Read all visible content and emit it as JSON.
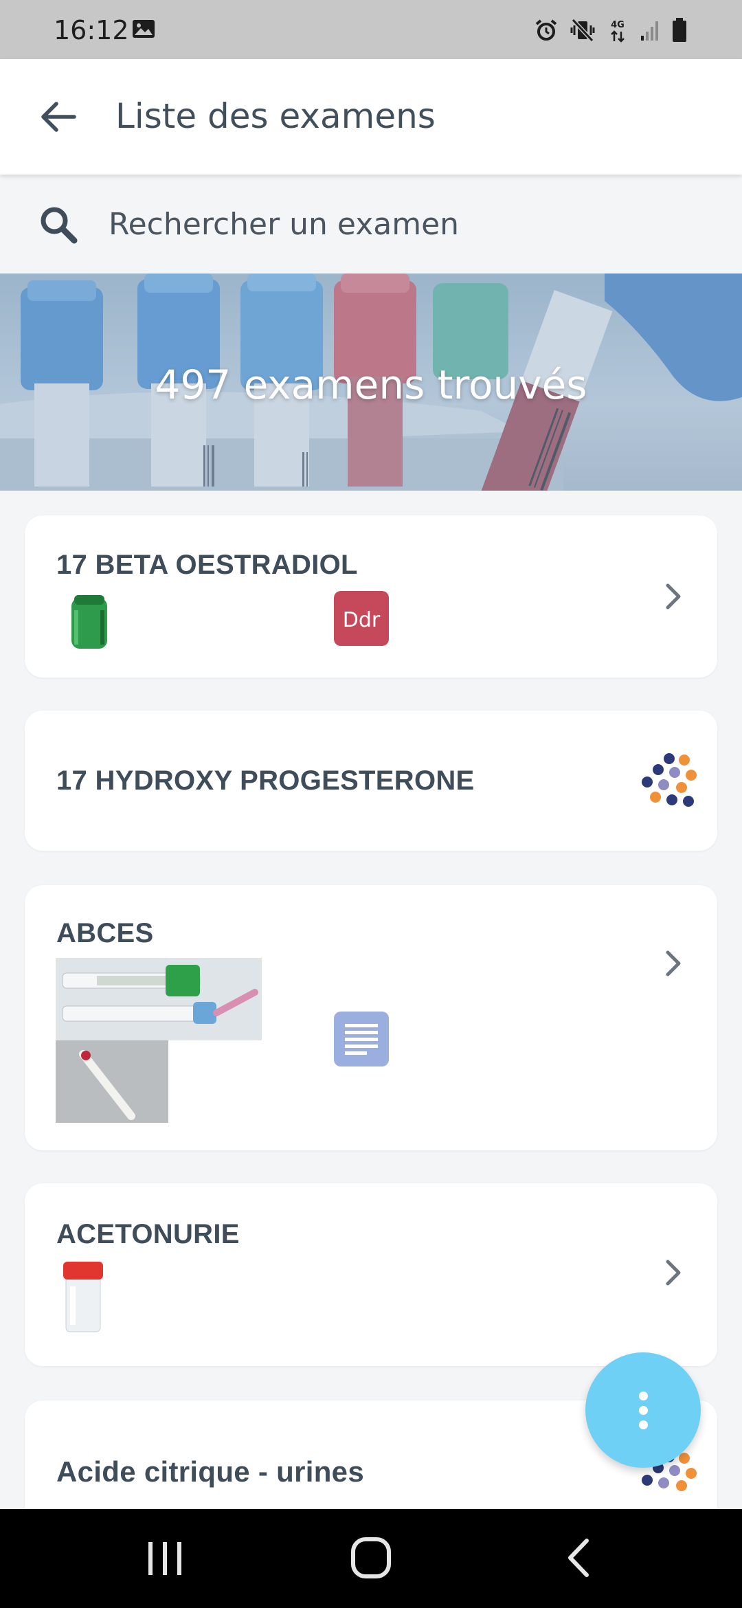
{
  "status_bar": {
    "time": "16:12",
    "icons": [
      "image-icon",
      "alarm-icon",
      "vibrate-icon",
      "4g-icon",
      "signal-icon",
      "battery-icon"
    ],
    "network_label": "4G"
  },
  "app_bar": {
    "title": "Liste des examens",
    "back_icon": "arrow-left-icon"
  },
  "search": {
    "placeholder": "Rechercher un examen",
    "value": "",
    "icon": "search-icon"
  },
  "banner": {
    "text": "497 examens trouvés"
  },
  "exams": [
    {
      "name": "17 BETA OESTRADIOL",
      "tube": "green-tube",
      "badge": "Ddr",
      "badge_color": "#c5495a",
      "action": "chevron-right"
    },
    {
      "name": "17 HYDROXY PROGESTERONE",
      "action": "partner-logo"
    },
    {
      "name": "ABCES",
      "images": [
        "syringes-photo",
        "swab-photo"
      ],
      "document_icon": "document-icon",
      "action": "chevron-right"
    },
    {
      "name": "ACETONURIE",
      "tube": "urine-cup",
      "action": "chevron-right"
    },
    {
      "name": "Acide citrique - urines",
      "action": "partner-logo"
    }
  ],
  "fab": {
    "icon": "more-vert-icon"
  },
  "nav_bar": {
    "recents": "recents-icon",
    "home": "home-icon",
    "back": "back-icon"
  },
  "colors": {
    "accent_fab": "#6fd0f5",
    "text_primary": "#3f4c5a",
    "background": "#f3f5f7",
    "ddr_badge": "#c5495a",
    "doc_badge": "#9aaee0",
    "logo_navy": "#2d3a7a",
    "logo_orange": "#f0913a",
    "logo_lavender": "#8f8cc4"
  }
}
